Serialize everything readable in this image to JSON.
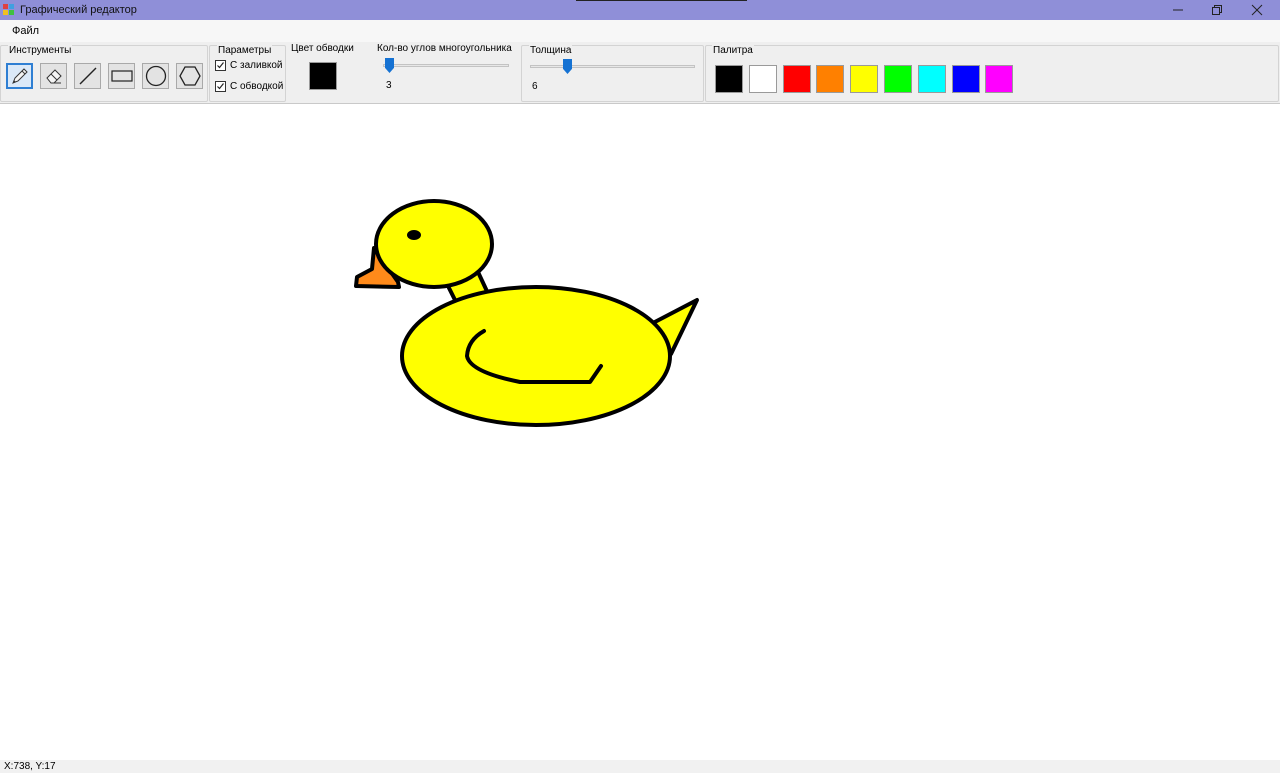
{
  "window": {
    "title": "Графический редактор",
    "controls": [
      "minimize-icon",
      "restore-icon",
      "close-icon"
    ]
  },
  "menu": {
    "file": "Файл"
  },
  "tools": {
    "label": "Инструменты",
    "items": [
      {
        "name": "pencil-icon",
        "active": true
      },
      {
        "name": "eraser-icon",
        "active": false
      },
      {
        "name": "line-icon",
        "active": false
      },
      {
        "name": "rectangle-icon",
        "active": false
      },
      {
        "name": "ellipse-icon",
        "active": false
      },
      {
        "name": "polygon-icon",
        "active": false
      }
    ]
  },
  "params": {
    "label": "Параметры",
    "fill_label": "С заливкой",
    "fill_checked": true,
    "outline_label": "С обводкой",
    "outline_checked": true
  },
  "outline_color": {
    "label": "Цвет обводки",
    "value": "#000000"
  },
  "polygon_corners": {
    "label": "Кол-во углов многоугольника",
    "value": "3"
  },
  "thickness": {
    "label": "Толщина",
    "value": "6"
  },
  "palette": {
    "label": "Палитра",
    "colors": [
      "#000000",
      "#ffffff",
      "#ff0000",
      "#ff8000",
      "#ffff00",
      "#00ff00",
      "#00ffff",
      "#0000ff",
      "#ff00ff"
    ]
  },
  "drawing": {
    "subject": "duck",
    "body_color": "#ffff00",
    "beak_color": "#ff8a1a",
    "outline_color": "#000000"
  },
  "status": {
    "coords": "X:738, Y:17"
  }
}
